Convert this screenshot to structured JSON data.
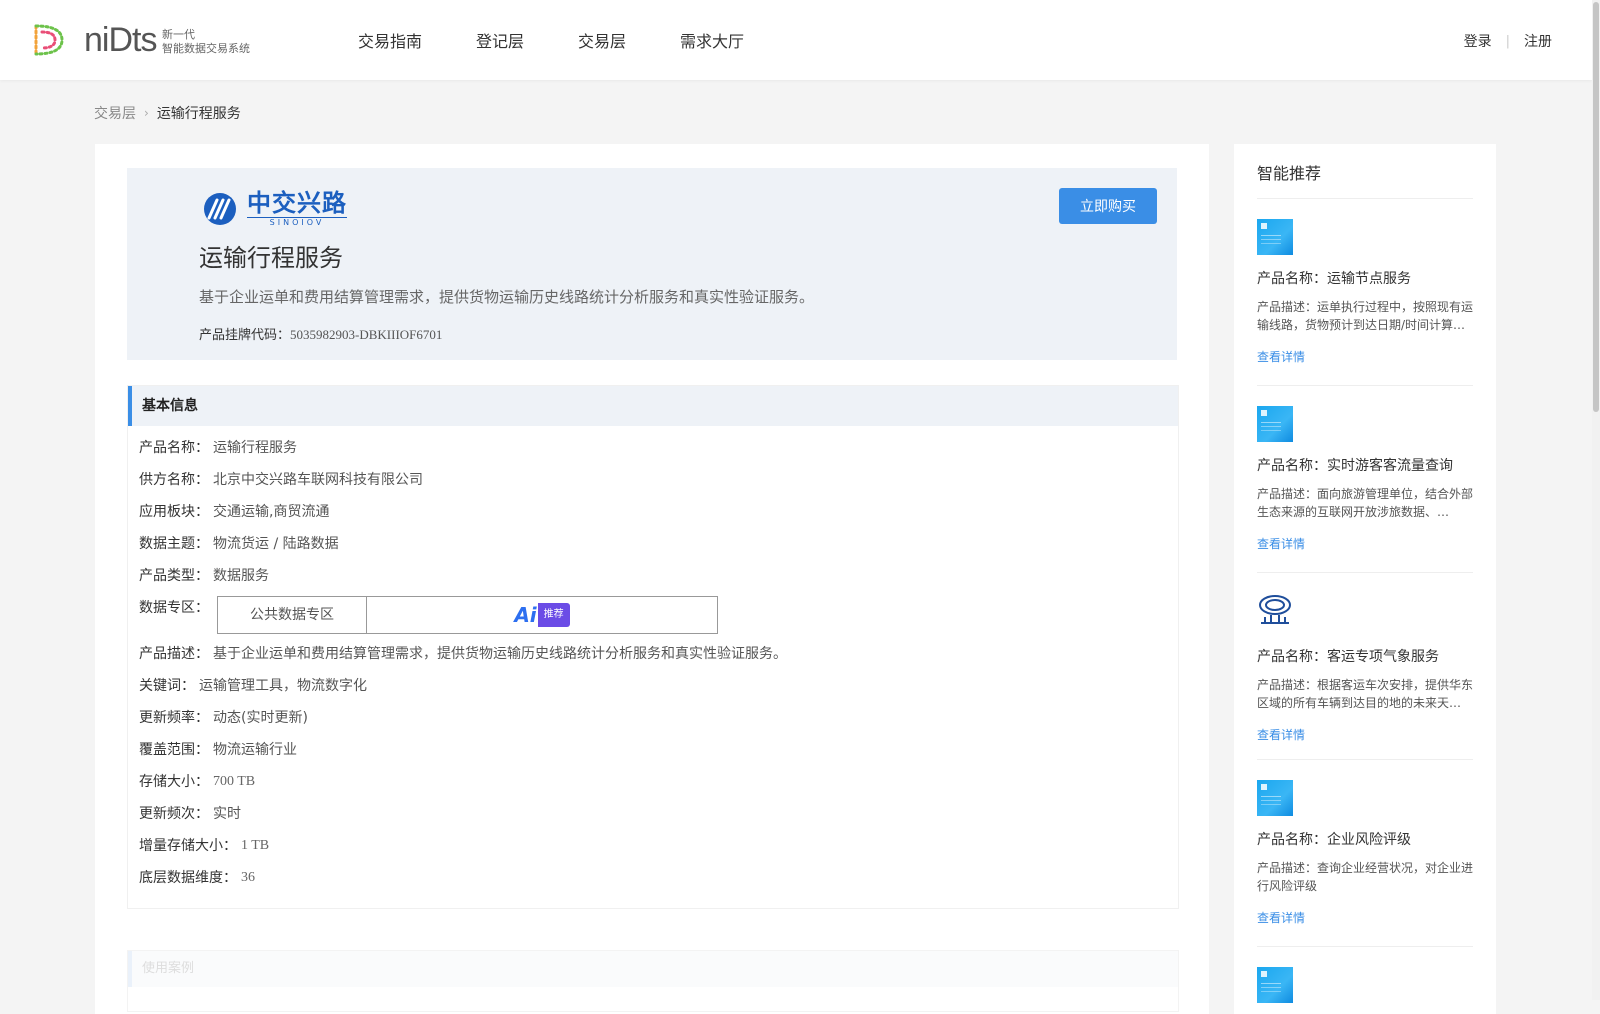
{
  "header": {
    "logo_word": "niDts",
    "logo_sub_line1": "新一代",
    "logo_sub_line2": "智能数据交易系统",
    "nav": [
      "交易指南",
      "登记层",
      "交易层",
      "需求大厅"
    ],
    "login": "登录",
    "register": "注册"
  },
  "breadcrumb": {
    "parent": "交易层",
    "current": "运输行程服务"
  },
  "hero": {
    "brand_cn": "中交兴路",
    "brand_en": "SINOIOV",
    "title": "运输行程服务",
    "description": "基于企业运单和费用结算管理需求，提供货物运输历史线路统计分析服务和真实性验证服务。",
    "code_label": "产品挂牌代码：",
    "code_value": "5035982903-DBKIIIOF6701",
    "buy_button": "立即购买"
  },
  "basic_info": {
    "title": "基本信息",
    "rows": [
      {
        "label": "产品名称：",
        "value": "运输行程服务"
      },
      {
        "label": "供方名称：",
        "value": "北京中交兴路车联网科技有限公司"
      },
      {
        "label": "应用板块：",
        "value": "交通运输,商贸流通"
      },
      {
        "label": "数据主题：",
        "value": "物流货运 / 陆路数据"
      },
      {
        "label": "产品类型：",
        "value": "数据服务"
      }
    ],
    "zone_label": "数据专区：",
    "zone_name": "公共数据专区",
    "zone_ai": "Ai",
    "zone_ai_tag": "推荐",
    "rows2": [
      {
        "label": "产品描述：",
        "value": "基于企业运单和费用结算管理需求，提供货物运输历史线路统计分析服务和真实性验证服务。"
      },
      {
        "label": "关键词：",
        "value": "运输管理工具，物流数字化"
      },
      {
        "label": "更新频率：",
        "value": "动态(实时更新)"
      },
      {
        "label": "覆盖范围：",
        "value": "物流运输行业"
      },
      {
        "label": "存储大小：",
        "value": "700 TB"
      },
      {
        "label": "更新频次：",
        "value": "实时"
      },
      {
        "label": "增量存储大小：",
        "value": "1 TB"
      },
      {
        "label": "底层数据维度：",
        "value": "36"
      }
    ]
  },
  "faded_section_title": "使用案例",
  "sidebar": {
    "title": "智能推荐",
    "items": [
      {
        "name": "产品名称：运输节点服务",
        "desc": "产品描述：运单执行过程中，按照现有运输线路，货物预计到达日期/时间计算服务",
        "link": "查看详情"
      },
      {
        "name": "产品名称：实时游客客流量查询",
        "desc": "产品描述：面向旅游管理单位，结合外部生态来源的互联网开放涉旅数据、…",
        "link": "查看详情"
      },
      {
        "name": "产品名称：客运专项气象服务",
        "desc": "产品描述：根据客运车次安排，提供华东区域的所有车辆到达目的地的未来天气预报",
        "link": "查看详情"
      },
      {
        "name": "产品名称：企业风险评级",
        "desc": "产品描述：查询企业经营状况，对企业进行风险评级",
        "link": "查看详情"
      }
    ]
  },
  "colors": {
    "accent": "#3a8ee6",
    "brand": "#1c5fbf",
    "hero_bg": "#eef2f7"
  }
}
